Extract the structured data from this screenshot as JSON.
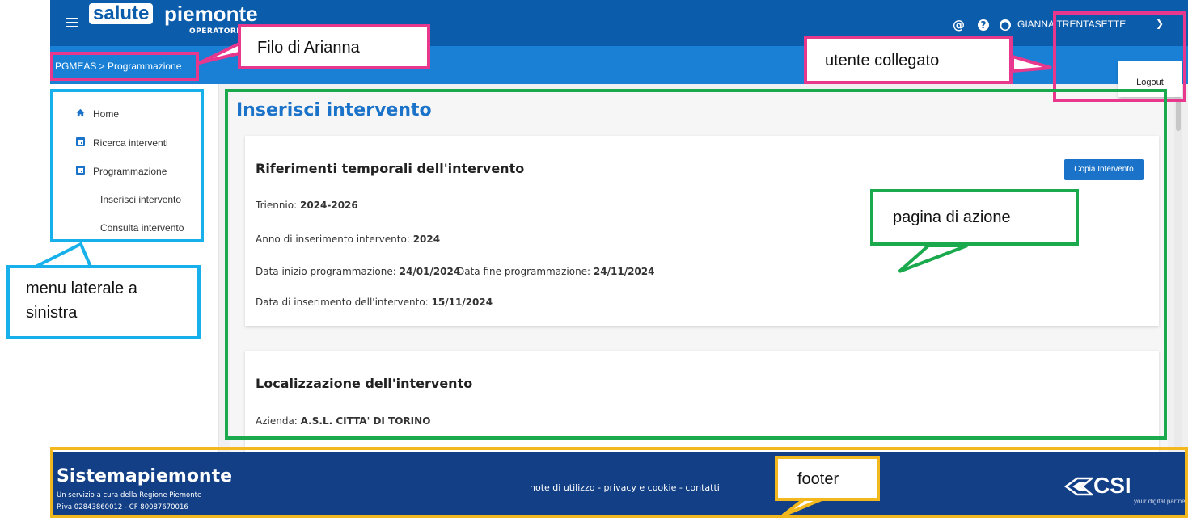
{
  "header": {
    "logo_salute": "salute",
    "logo_piemonte": "piemonte",
    "logo_operatori": "OPERATORI",
    "icons": [
      "menu-icon",
      "at-icon",
      "help-icon",
      "user-icon",
      "chevron-down-icon"
    ],
    "user_name": "GIANNA TRENTASETTE"
  },
  "breadcrumb": "PGMEAS > Programmazione",
  "user_menu": {
    "logout_label": "Logout"
  },
  "sidebar": {
    "items": [
      {
        "label": "Home",
        "icon": "home-icon"
      },
      {
        "label": "Ricerca interventi",
        "icon": "calendar-icon"
      },
      {
        "label": "Programmazione",
        "icon": "calendar-icon"
      },
      {
        "label": "Inserisci intervento"
      },
      {
        "label": "Consulta intervento"
      }
    ]
  },
  "page": {
    "title": "Inserisci intervento",
    "section1": {
      "title": "Riferimenti temporali dell'intervento",
      "copy_button": "Copia Intervento",
      "triennio_label": "Triennio: ",
      "triennio_value": "2024-2026",
      "anno_label": "Anno di inserimento intervento: ",
      "anno_value": "2024",
      "inizio_label": "Data inizio programmazione: ",
      "inizio_value": "24/01/2024",
      "fine_label": "Data fine programmazione: ",
      "fine_value": "24/11/2024",
      "inserimento_label": "Data di inserimento dell'intervento: ",
      "inserimento_value": "15/11/2024"
    },
    "section2": {
      "title": "Localizzazione dell'intervento",
      "azienda_label": "Azienda: ",
      "azienda_value": "A.S.L. CITTA' DI TORINO"
    }
  },
  "footer": {
    "brand": "Sistemapiemonte",
    "line1": "Un servizio a cura della Regione Piemonte",
    "line2": "P.iva 02843860012 - CF 80087670016",
    "link_note": "note di utilizzo",
    "link_privacy": "privacy e cookie",
    "link_contatti": "contatti",
    "separator": " - ",
    "csi_text": "CSI",
    "csi_tagline": "your digital partner"
  },
  "annotations": {
    "filo": "Filo di Arianna",
    "utente": "utente collegato",
    "menu_line1": "menu laterale a",
    "menu_line2": "sinistra",
    "pagina": "pagina di azione",
    "footer": "footer",
    "colors": {
      "pink": "#e7388e",
      "blue": "#18b0ea",
      "green": "#1aaa4d",
      "yellow": "#f2b81d"
    }
  },
  "theme": {
    "header_blue": "#0b5cab",
    "subbar_blue": "#1980d6",
    "accent": "#1a73c9",
    "footer_navy": "#123f86"
  }
}
